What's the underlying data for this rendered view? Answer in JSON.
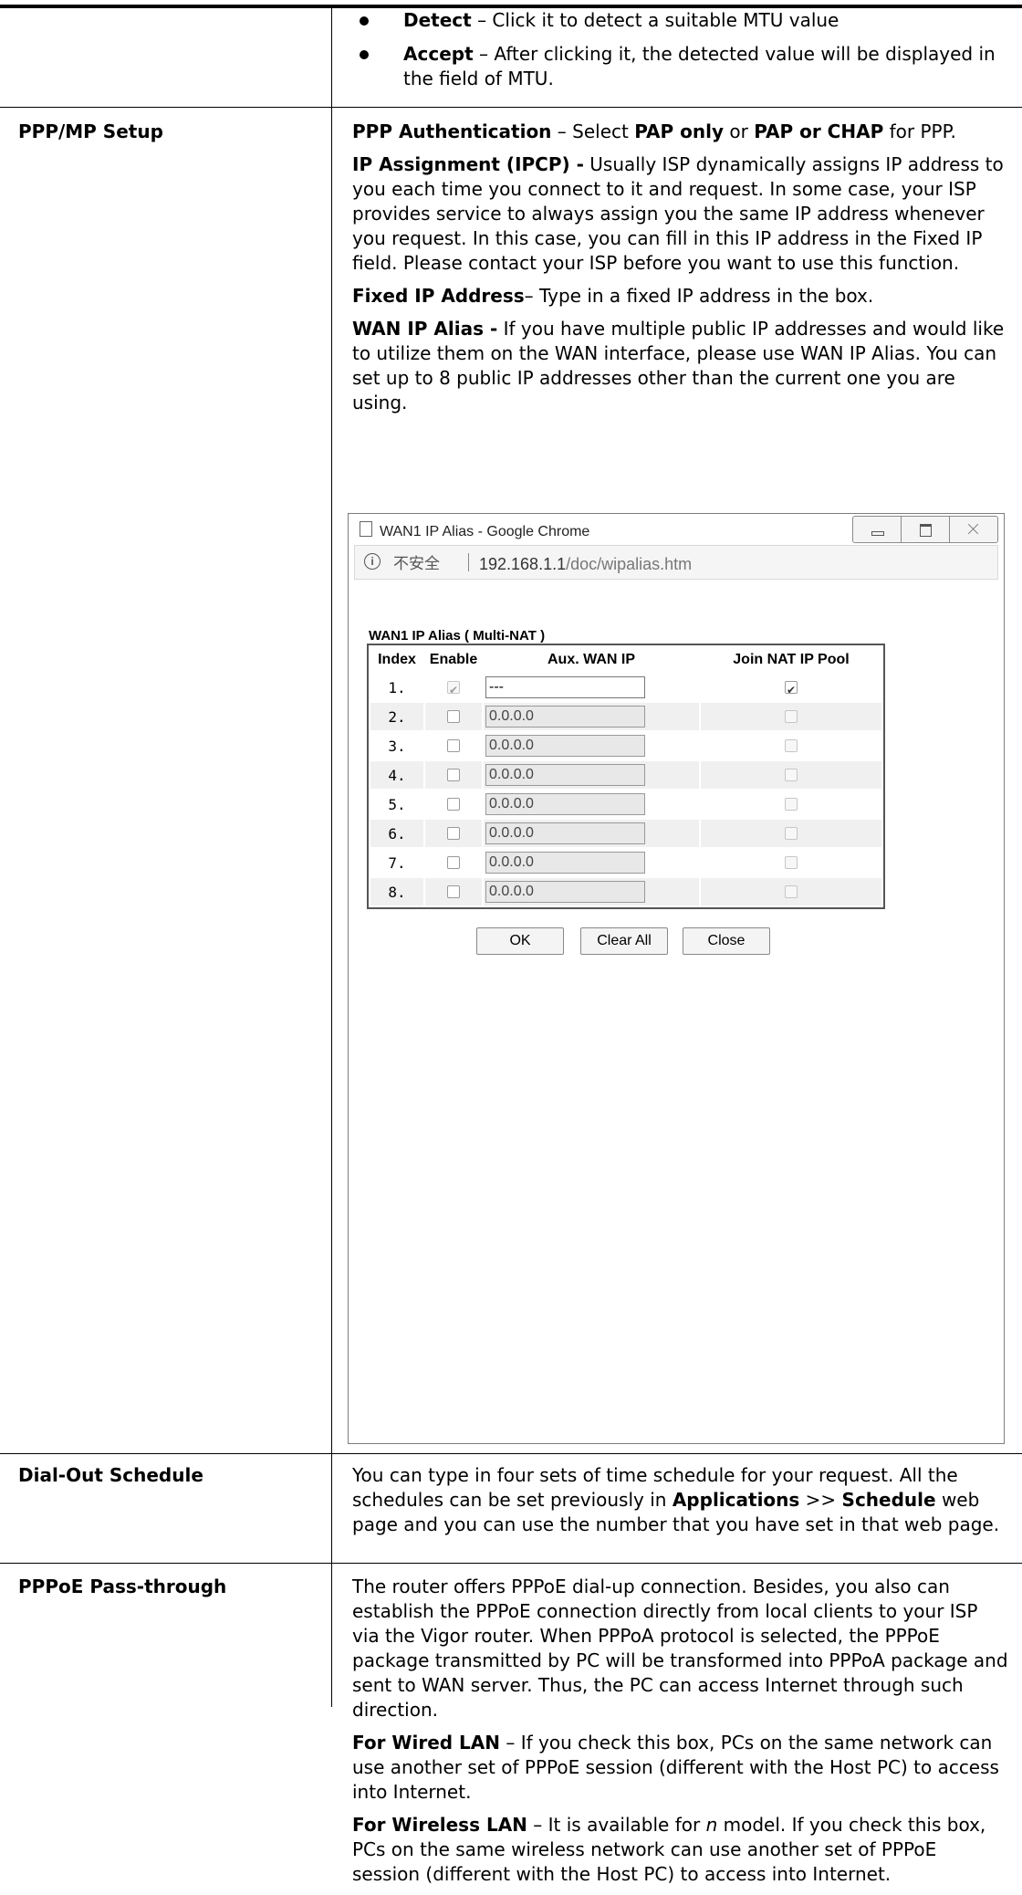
{
  "rows": [
    {
      "bullets": [
        {
          "term": "Detect",
          "text": " – Click it to detect a suitable MTU value"
        },
        {
          "term": "Accept",
          "text": " – After clicking it, the detected value will be displayed in the field of MTU."
        }
      ]
    },
    {
      "label": "PPP/MP Setup",
      "p1": {
        "a": "PPP Authentication",
        "b": " – Select ",
        "c": "PAP only",
        "d": " or ",
        "e": "PAP or CHAP",
        "f": " for PPP."
      },
      "p2": {
        "a": "IP Assignment (IPCP) -",
        "b": " Usually ISP dynamically assigns IP address to you each time you connect to it and request. In some case, your ISP provides service to always assign you the same IP address whenever you request. In this case, you can fill in this IP address in the Fixed IP field. Please contact your ISP before you want to use this function."
      },
      "p3": {
        "a": "Fixed IP Address",
        "b": "– Type in a fixed IP address in the box."
      },
      "p4": {
        "a": "WAN IP Alias -",
        "b": " If you have multiple public IP addresses and would like to utilize them on the WAN interface, please use WAN IP Alias. You can set up to 8 public IP addresses other than the current one you are using."
      }
    },
    {
      "label": "Dial-Out Schedule",
      "p1": {
        "a": "You can type in four sets of time schedule for your request. All the schedules can be set previously in ",
        "b": "Applications",
        "c": " >> ",
        "d": "Schedule",
        "e": " web page and you can use the number that you have set in that web page."
      }
    },
    {
      "label": "PPPoE Pass-through",
      "p1": "The router offers PPPoE dial-up connection. Besides, you also can establish the PPPoE connection directly from local clients to your ISP via the Vigor router. When PPPoA protocol is selected, the PPPoE package transmitted by PC will be transformed into PPPoA package and sent to WAN server. Thus, the PC can access Internet through such direction.",
      "p2": {
        "a": "For Wired LAN",
        "b": " – If you check this box, PCs on the same network can use another set of PPPoE session (different with the Host PC) to access into Internet."
      },
      "p3": {
        "a": "For Wireless LAN",
        "b": " – It is available for ",
        "c": "n",
        "d": " model. If you check this box, PCs on the same wireless network can use another set of PPPoE session (different with the Host PC) to access into Internet."
      }
    }
  ],
  "popup": {
    "window_title": "WAN1 IP Alias - Google Chrome",
    "security_label": "不安全",
    "url_host": "192.168.1.1",
    "url_path": "/doc/wipalias.htm",
    "content_title": "WAN1 IP Alias ( Multi-NAT )",
    "headers": [
      "Index",
      "Enable",
      "Aux. WAN IP",
      "Join NAT IP Pool"
    ],
    "entries": [
      {
        "index": "1.",
        "enabled": true,
        "ip": "---",
        "join_nat": true
      },
      {
        "index": "2.",
        "enabled": false,
        "ip": "0.0.0.0",
        "join_nat": false
      },
      {
        "index": "3.",
        "enabled": false,
        "ip": "0.0.0.0",
        "join_nat": false
      },
      {
        "index": "4.",
        "enabled": false,
        "ip": "0.0.0.0",
        "join_nat": false
      },
      {
        "index": "5.",
        "enabled": false,
        "ip": "0.0.0.0",
        "join_nat": false
      },
      {
        "index": "6.",
        "enabled": false,
        "ip": "0.0.0.0",
        "join_nat": false
      },
      {
        "index": "7.",
        "enabled": false,
        "ip": "0.0.0.0",
        "join_nat": false
      },
      {
        "index": "8.",
        "enabled": false,
        "ip": "0.0.0.0",
        "join_nat": false
      }
    ],
    "buttons": {
      "ok": "OK",
      "clear_all": "Clear All",
      "close": "Close"
    }
  }
}
